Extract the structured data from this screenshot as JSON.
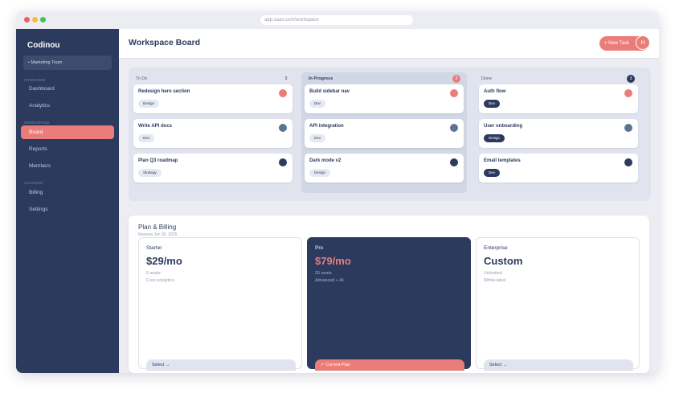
{
  "browser": {
    "url": "app.saas.com/workspace"
  },
  "sidebar": {
    "brand": "Codinou",
    "team_selector": "• Marketing Team",
    "sections": [
      {
        "label": "OVERVIEW",
        "items": [
          "Dashboard",
          "Analytics"
        ]
      },
      {
        "label": "WORKSPACE",
        "items": [
          "Board",
          "Reports",
          "Members"
        ]
      },
      {
        "label": "ACCOUNT",
        "items": [
          "Billing",
          "Settings"
        ]
      }
    ],
    "active_item": "Board"
  },
  "header": {
    "title": "Workspace Board",
    "new_task_label": "+ New Task",
    "avatar_initial": "H"
  },
  "board": {
    "columns": [
      {
        "title": "To Do",
        "count": "3",
        "cards": [
          {
            "title": "Redesign hero section",
            "tag": "Design",
            "dot_color": "#ea7d79"
          },
          {
            "title": "Write API docs",
            "tag": "Dev",
            "dot_color": "#5a7494"
          },
          {
            "title": "Plan Q3 roadmap",
            "tag": "Strategy",
            "dot_color": "#2c3a5e"
          }
        ]
      },
      {
        "title": "In Progress",
        "count": "2",
        "cards": [
          {
            "title": "Build sidebar nav",
            "tag": "Dev",
            "dot_color": "#ea7d79"
          },
          {
            "title": "API integration",
            "tag": "Dev",
            "dot_color": "#5a7494"
          },
          {
            "title": "Dark mode v2",
            "tag": "Design",
            "dot_color": "#2c3a5e"
          }
        ]
      },
      {
        "title": "Done",
        "count": "3",
        "cards": [
          {
            "title": "Auth flow",
            "tag": "Dev",
            "dot_color": "#ea7d79"
          },
          {
            "title": "User onboarding",
            "tag": "Design",
            "dot_color": "#5a7494"
          },
          {
            "title": "Email templates",
            "tag": "Dev",
            "dot_color": "#2c3a5e"
          }
        ]
      }
    ]
  },
  "billing": {
    "title": "Plan & Billing",
    "renewal": "Renews Jun 30, 2025",
    "plans": [
      {
        "name": "Starter",
        "price": "$29/mo",
        "features": [
          "5 seats",
          "Core analytics"
        ],
        "button": "Select →"
      },
      {
        "name": "Pro",
        "price": "$79/mo",
        "features": [
          "25 seats",
          "Advanced + AI"
        ],
        "button": "✓ Current Plan"
      },
      {
        "name": "Enterprise",
        "price": "Custom",
        "features": [
          "Unlimited",
          "White-label"
        ],
        "button": "Select →"
      }
    ]
  },
  "colors": {
    "sidebar": "#2c3a5e",
    "accent": "#ea7d79",
    "muted_blue": "#5a7494",
    "background": "#ecedf3"
  }
}
